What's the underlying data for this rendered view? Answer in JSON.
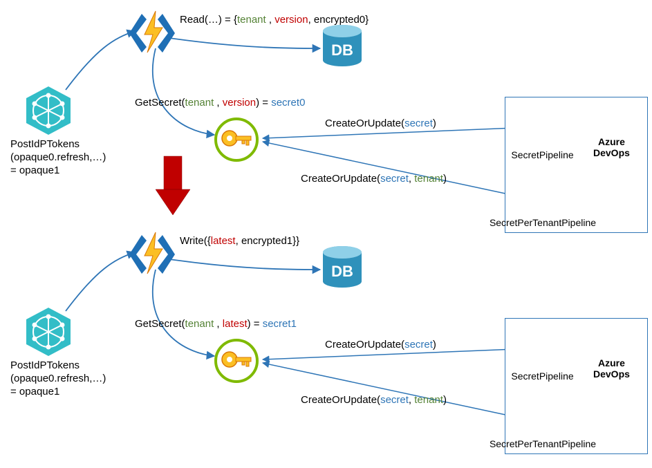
{
  "flows": [
    {
      "post": {
        "fn": "PostIdPTokens",
        "arg_opaque": "(opaque0.refresh,…)",
        "equals": "= opaque1"
      },
      "read": {
        "prefix": "Read(…) = {",
        "tenant": "tenant",
        "sep1": " , ",
        "version": "version",
        "sep2": ", ",
        "tail": "encrypted0}"
      },
      "getsecret": {
        "prefix": "GetSecret(",
        "tenant": "tenant",
        "sep1": " , ",
        "version": "version",
        "sep2": ") = ",
        "secret": "secret0"
      }
    },
    {
      "post": {
        "fn": "PostIdPTokens",
        "arg_opaque": "(opaque0.refresh,…)",
        "equals": "= opaque1"
      },
      "write": {
        "prefix": "Write({",
        "latest": "latest",
        "sep": ", ",
        "tail": "encrypted1}}"
      },
      "getsecret": {
        "prefix": "GetSecret(",
        "tenant": "tenant",
        "sep1": " , ",
        "version": "latest",
        "sep2": ") = ",
        "secret": "secret1"
      }
    }
  ],
  "pipelines": {
    "createOrUpdate": {
      "prefix": "CreateOrUpdate(",
      "secret": "secret",
      "sep": ", ",
      "tenant": "tenant",
      "close": ")"
    },
    "secretPipeline": "SecretPipeline",
    "secretPerTenantPipeline": "SecretPerTenantPipeline",
    "azureDevOps_line1": "Azure",
    "azureDevOps_line2": "DevOps"
  },
  "db_label": "DB"
}
